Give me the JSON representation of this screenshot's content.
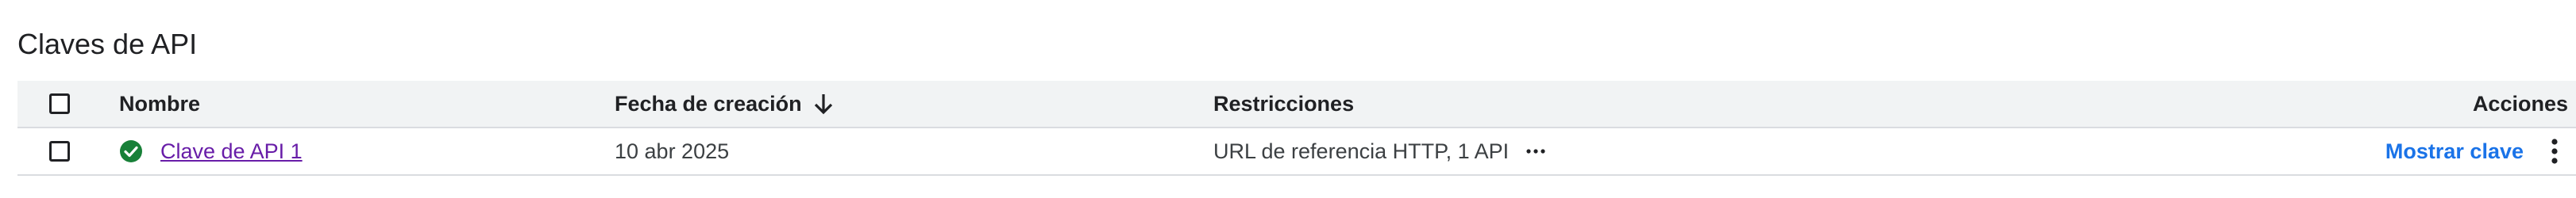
{
  "section": {
    "title": "Claves de API"
  },
  "table": {
    "headers": {
      "name": "Nombre",
      "created": "Fecha de creación",
      "restrictions": "Restricciones",
      "actions": "Acciones"
    },
    "sort": {
      "column": "created",
      "direction": "descending",
      "icon": "arrow-down-icon"
    },
    "rows": [
      {
        "status_icon": "check-circle-icon",
        "status_color": "#188038",
        "name": "Clave de API 1",
        "created": "10 abr 2025",
        "restrictions": "URL de referencia HTTP, 1 API",
        "show_key_label": "Mostrar clave"
      }
    ]
  },
  "colors": {
    "header_bg": "#f1f3f4",
    "link_visited": "#681da8",
    "action_blue": "#1a73e8",
    "divider": "#dadce0"
  }
}
